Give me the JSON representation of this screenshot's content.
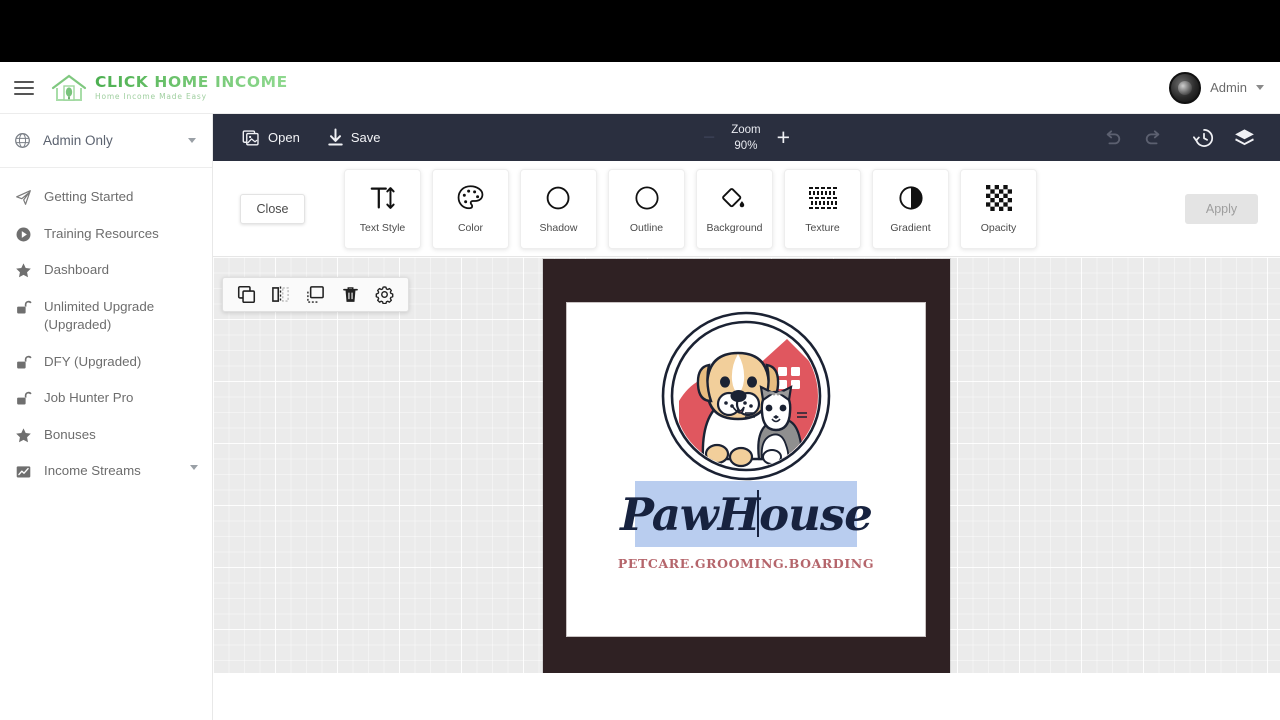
{
  "header": {
    "menu_icon": "hamburger-icon",
    "brand_title": "CLICK HOME INCOME",
    "brand_tagline": "Home Income Made Easy",
    "user_name": "Admin",
    "user_caret": "chevron-down-icon"
  },
  "sidebar": {
    "scope_selector": {
      "label": "Admin Only",
      "icon": "globe-icon",
      "caret": "chevron-down-icon"
    },
    "items": [
      {
        "label": "Getting Started",
        "icon": "paper-plane-icon",
        "has_caret": false
      },
      {
        "label": "Training Resources",
        "icon": "play-circle-icon",
        "has_caret": false
      },
      {
        "label": "Dashboard",
        "icon": "star-icon",
        "has_caret": false
      },
      {
        "label": "Unlimited Upgrade (Upgraded)",
        "icon": "unlock-icon",
        "has_caret": false
      },
      {
        "label": "DFY (Upgraded)",
        "icon": "unlock-icon",
        "has_caret": false
      },
      {
        "label": "Job Hunter Pro",
        "icon": "unlock-icon",
        "has_caret": false
      },
      {
        "label": "Bonuses",
        "icon": "star-icon",
        "has_caret": false
      },
      {
        "label": "Income Streams",
        "icon": "chart-icon",
        "has_caret": true
      }
    ]
  },
  "toolbar": {
    "open_label": "Open",
    "open_icon": "image-open-icon",
    "save_label": "Save",
    "save_icon": "download-icon",
    "zoom_label": "Zoom",
    "zoom_value": "90%",
    "zoom_out_glyph": "−",
    "zoom_in_glyph": "+",
    "undo_icon": "undo-arrow-icon",
    "redo_icon": "redo-arrow-icon",
    "history_icon": "history-clock-icon",
    "layers_icon": "layers-icon",
    "bg_color": "#2a2f3f"
  },
  "tool_strip": {
    "close_label": "Close",
    "apply_label": "Apply",
    "apply_disabled": true,
    "tools": [
      {
        "label": "Text Style",
        "icon": "text-height-icon"
      },
      {
        "label": "Color",
        "icon": "palette-icon"
      },
      {
        "label": "Shadow",
        "icon": "shadow-circle-icon"
      },
      {
        "label": "Outline",
        "icon": "outline-circle-icon"
      },
      {
        "label": "Background",
        "icon": "paint-bucket-icon"
      },
      {
        "label": "Texture",
        "icon": "texture-weave-icon"
      },
      {
        "label": "Gradient",
        "icon": "half-filled-circle-icon"
      },
      {
        "label": "Opacity",
        "icon": "checkerboard-icon"
      }
    ]
  },
  "object_toolbar": {
    "actions": [
      {
        "icon": "duplicate-icon"
      },
      {
        "icon": "flip-horizontal-icon"
      },
      {
        "icon": "bring-to-front-icon"
      },
      {
        "icon": "trash-icon"
      },
      {
        "icon": "gear-icon"
      }
    ]
  },
  "canvas": {
    "frame_color": "#2f2123",
    "artboard_bg": "#ffffff",
    "logo": {
      "brand_text": "PawHouse",
      "brand_text_color": "#17223f",
      "selection_highlight_color": "#b9cdef",
      "tagline": "PETCARE.GROOMING.BOARDING",
      "tagline_color": "#b5656b",
      "mark_icon": "dog-cat-house-circle-icon",
      "house_color": "#e0575f",
      "dog_color": "#f2cf9b",
      "cat_color": "#9a9a9a"
    }
  }
}
